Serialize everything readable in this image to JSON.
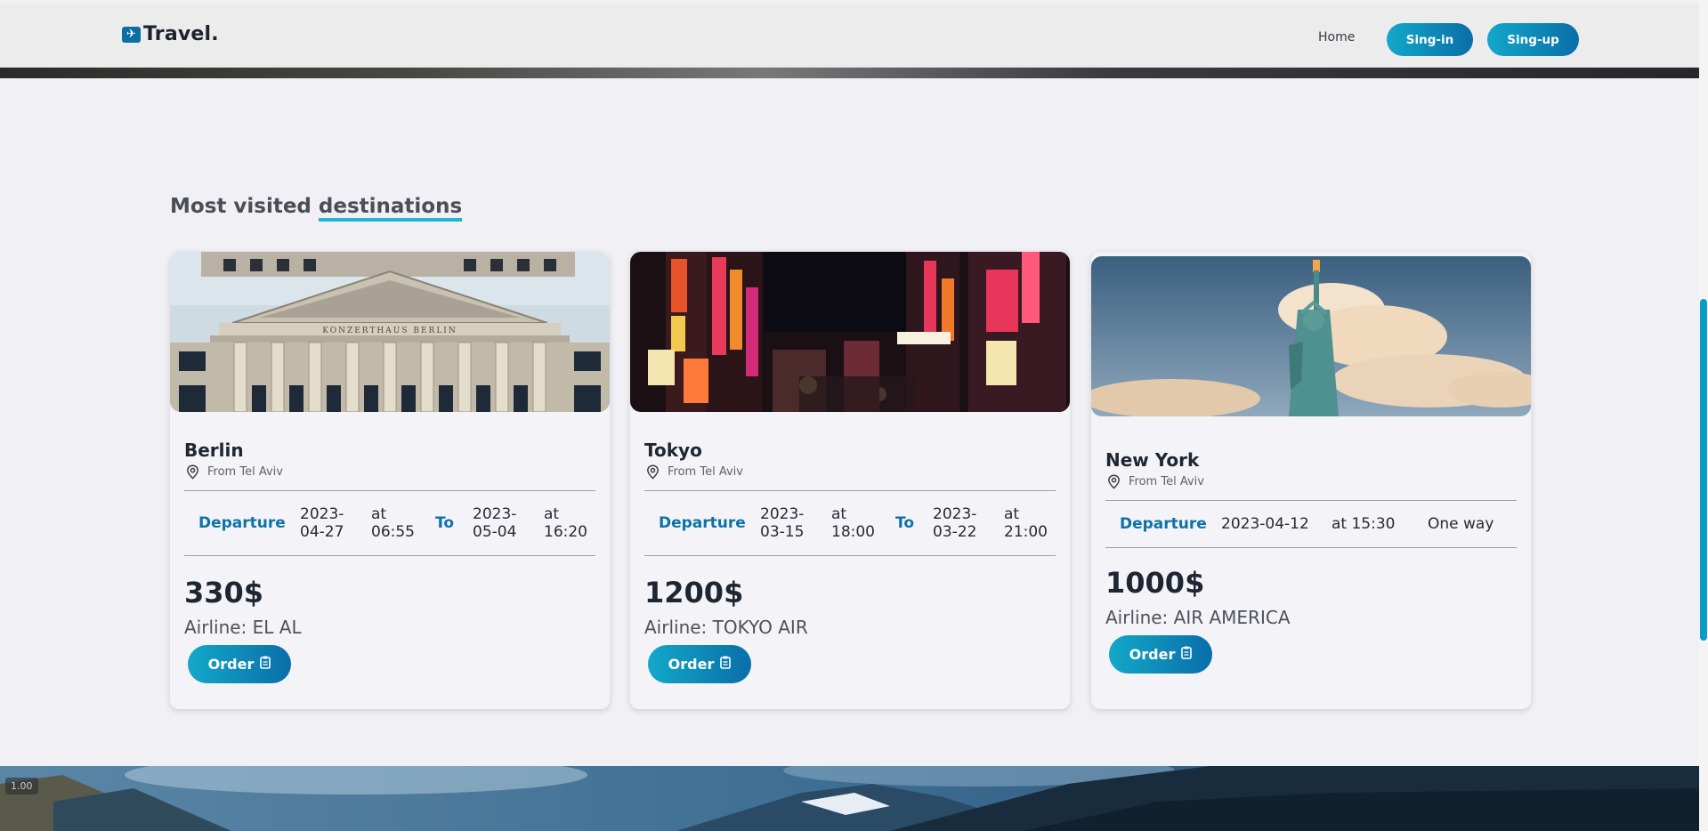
{
  "nav": {
    "logo_text": "Travel.",
    "home_label": "Home",
    "signin_label": "Sing-in",
    "signup_label": "Sing-up"
  },
  "section": {
    "title_main": "Most visited ",
    "title_highlight": "destinations"
  },
  "cards": [
    {
      "city": "Berlin",
      "from": "From Tel Aviv",
      "departure_label": "Departure",
      "departure_date": "2023-04-27",
      "departure_time": "at 06:55",
      "to_label": "To",
      "return_date": "2023-05-04",
      "return_time": "at 16:20",
      "price": "330$",
      "airline": "Airline: EL AL",
      "order_label": "Order"
    },
    {
      "city": "Tokyo",
      "from": "From Tel Aviv",
      "departure_label": "Departure",
      "departure_date": "2023-03-15",
      "departure_time": "at 18:00",
      "to_label": "To",
      "return_date": "2023-03-22",
      "return_time": "at 21:00",
      "price": "1200$",
      "airline": "Airline: TOKYO AIR",
      "order_label": "Order"
    },
    {
      "city": "New York",
      "from": "From Tel Aviv",
      "departure_label": "Departure",
      "departure_date": "2023-04-12",
      "departure_time": "at 15:30",
      "trip_type": "One way",
      "price": "1000$",
      "airline": "Airline: AIR AMERICA",
      "order_label": "Order"
    }
  ],
  "overlay": {
    "zoom": "1.00"
  },
  "colors": {
    "accent_start": "#12a8c9",
    "accent_end": "#0a6ea8",
    "keyword": "#0c73a6",
    "underline": "#22b3d0",
    "background": "#f1f0f5"
  },
  "icons": [
    "plane-icon",
    "location-pin-icon",
    "clipboard-icon"
  ]
}
